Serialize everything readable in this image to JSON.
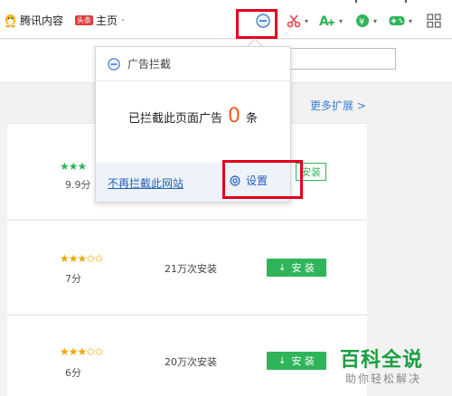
{
  "toolbar": {
    "bookmarks": [
      {
        "label": "腾讯内容"
      },
      {
        "badge": "头条",
        "label": "主页"
      }
    ]
  },
  "page": {
    "more_extensions": "更多扩展 >",
    "items": [
      {
        "stars": "★★★",
        "score": "9.9分",
        "installs": "",
        "install_label": "安装"
      },
      {
        "stars": "★★★✩✩",
        "score": "7分",
        "installs": "21万次安装",
        "install_label": "安 装"
      },
      {
        "stars": "★★★✩✩",
        "score": "6分",
        "installs": "20万次安装",
        "install_label": "安 装"
      }
    ]
  },
  "popup": {
    "title": "广告拦截",
    "blocked_prefix": "已拦截此页面广告",
    "blocked_count": "0",
    "blocked_suffix": "条",
    "unblock_link": "不再拦截此网站",
    "settings_label": "设置"
  },
  "watermark": {
    "main": "百科全说",
    "sub": "助你轻松解决"
  },
  "colors": {
    "accent_red": "#e3001b",
    "install_green": "#2fb45a",
    "link_blue": "#2261b8",
    "count_orange": "#ff5a1f"
  }
}
